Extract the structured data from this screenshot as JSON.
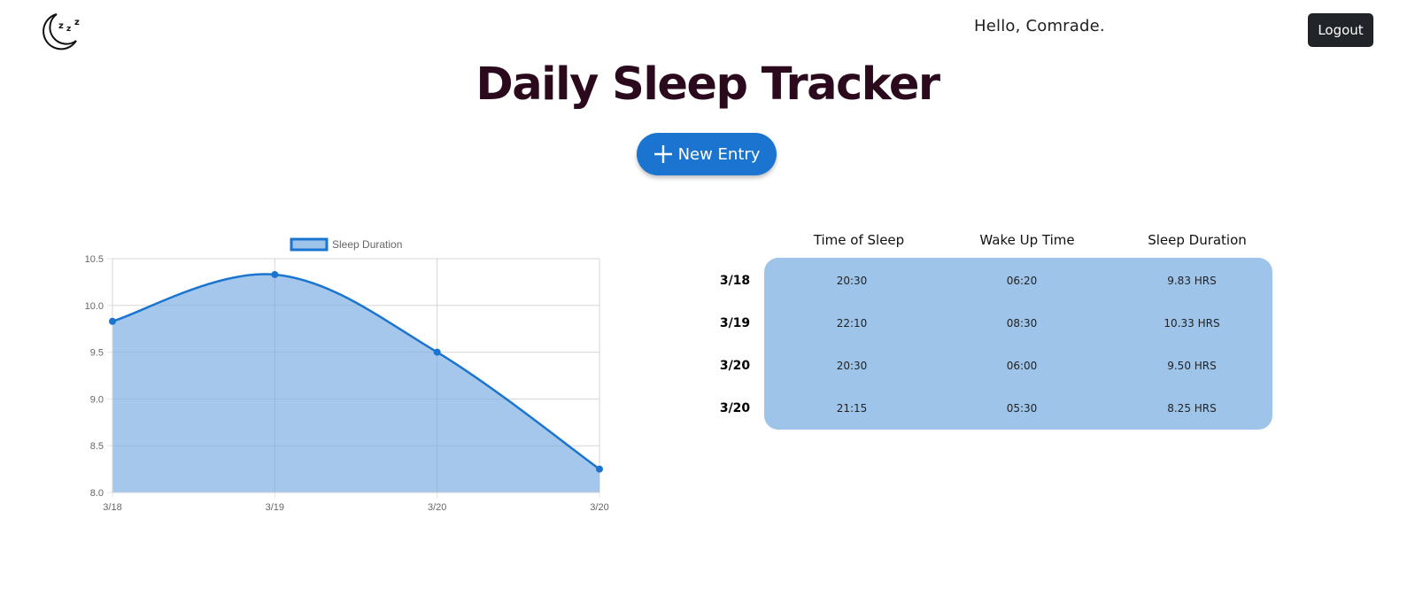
{
  "header": {
    "greeting": "Hello, Comrade.",
    "logout_label": "Logout",
    "logo_icon": "moon-zzz-icon"
  },
  "page": {
    "title": "Daily Sleep Tracker",
    "new_entry_label": "New Entry",
    "new_entry_icon": "plus-icon"
  },
  "colors": {
    "accent": "#1b75d0",
    "fill": "#9fc4ea",
    "title": "#2b0a1e",
    "dark_button": "#212529"
  },
  "chart_data": {
    "type": "area",
    "categories": [
      "3/18",
      "3/19",
      "3/20",
      "3/20"
    ],
    "series": [
      {
        "name": "Sleep Duration",
        "values": [
          9.83,
          10.33,
          9.5,
          8.25
        ]
      }
    ],
    "yticks": [
      "10.5",
      "10.0",
      "9.5",
      "9.0",
      "8.5",
      "8.0"
    ],
    "ylim": [
      8.0,
      10.5
    ],
    "grid": true,
    "legend": "top"
  },
  "table": {
    "headers": [
      "Time of Sleep",
      "Wake Up Time",
      "Sleep Duration"
    ],
    "rows": [
      {
        "date": "3/18",
        "sleep": "20:30",
        "wake": "06:20",
        "duration": "9.83 HRS"
      },
      {
        "date": "3/19",
        "sleep": "22:10",
        "wake": "08:30",
        "duration": "10.33 HRS"
      },
      {
        "date": "3/20",
        "sleep": "20:30",
        "wake": "06:00",
        "duration": "9.50 HRS"
      },
      {
        "date": "3/20",
        "sleep": "21:15",
        "wake": "05:30",
        "duration": "8.25 HRS"
      }
    ]
  }
}
